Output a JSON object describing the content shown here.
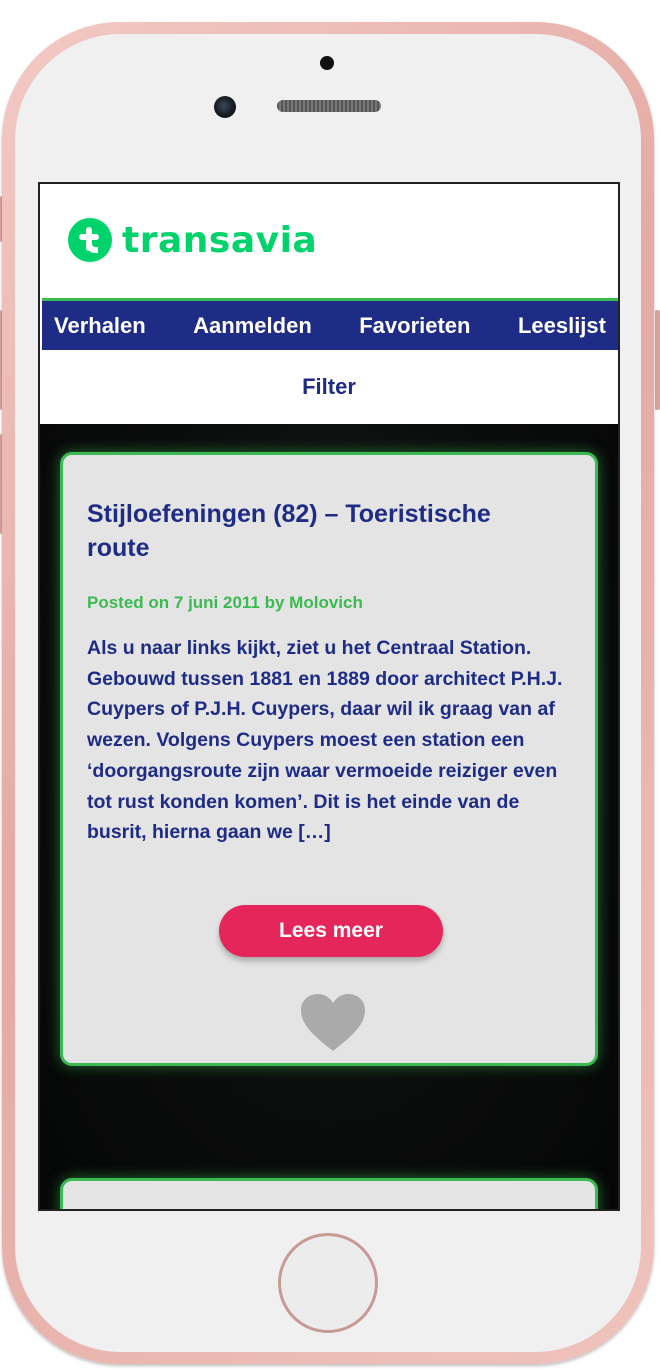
{
  "brand": {
    "name": "transavia",
    "color": "#00d36c"
  },
  "nav": {
    "items": [
      {
        "label": "Verhalen"
      },
      {
        "label": "Aanmelden"
      },
      {
        "label": "Favorieten"
      },
      {
        "label": "Leeslijst"
      }
    ]
  },
  "filter": {
    "label": "Filter"
  },
  "post": {
    "title": "Stijloefeningen (82) – Toeristische route",
    "meta": "Posted on 7 juni 2011 by Molovich",
    "excerpt": "Als u naar links kijkt, ziet u het Centraal Station. Gebouwd tussen 1881 en 1889 door architect P.H.J. Cuypers of P.J.H. Cuypers, daar wil ik graag van af wezen. Volgens Cuypers moest een station een ‘doorgangsroute zijn waar vermoeide reiziger even tot rust konden komen’. Dit is het einde van de busrit, hierna gaan we […]",
    "read_more_label": "Lees meer",
    "favorite_icon": "heart-icon"
  },
  "colors": {
    "primary": "#1e2c86",
    "accent_green": "#3cba52",
    "button": "#e5265a",
    "heart": "#aaaaaa"
  }
}
